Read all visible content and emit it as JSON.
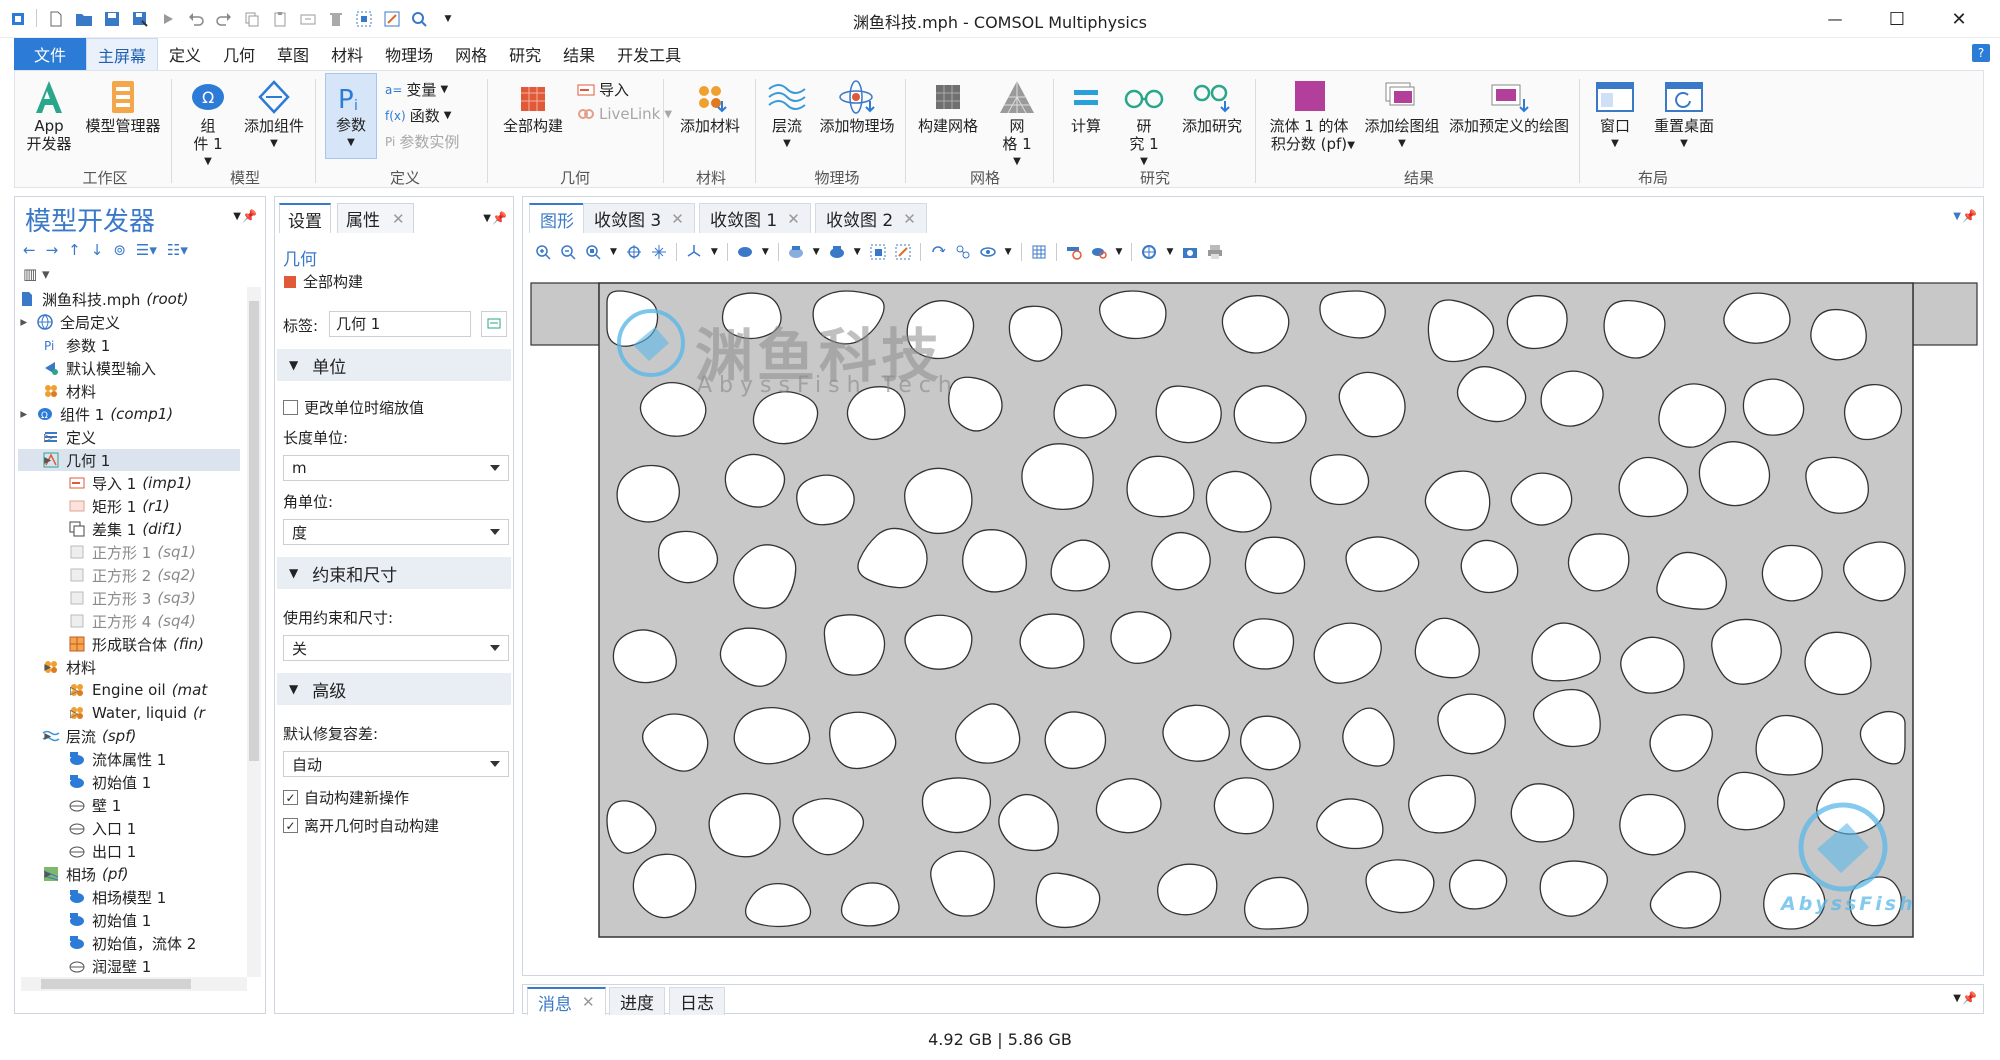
{
  "window": {
    "title": "渊鱼科技.mph - COMSOL Multiphysics",
    "minimize_glyph": "—",
    "maximize_glyph": "☐",
    "close_glyph": "✕"
  },
  "menu": {
    "items": [
      "文件",
      "主屏幕",
      "定义",
      "几何",
      "草图",
      "材料",
      "物理场",
      "网格",
      "研究",
      "结果",
      "开发工具"
    ],
    "active": "主屏幕",
    "help": "?"
  },
  "ribbon": {
    "workspace": {
      "label": "工作区",
      "app_dev": "App\n开发器",
      "model_manager": "模型管理器"
    },
    "model": {
      "label": "模型",
      "component": "组\n件 1",
      "add_component": "添加组件"
    },
    "definitions": {
      "label": "定义",
      "parameters": "参数",
      "variables": "变量",
      "functions": "函数",
      "param_case": "参数实例"
    },
    "geometry": {
      "label": "几何",
      "build_all": "全部构建",
      "import": "导入",
      "livelink": "LiveLink"
    },
    "materials": {
      "label": "材料",
      "add_material": "添加材料"
    },
    "physics": {
      "label": "物理场",
      "laminar": "层流",
      "add_physics": "添加物理场"
    },
    "mesh": {
      "label": "网格",
      "build_mesh": "构建网格",
      "mesh1": "网\n格 1"
    },
    "study": {
      "label": "研究",
      "compute": "计算",
      "study1": "研\n究 1",
      "add_study": "添加研究"
    },
    "results": {
      "label": "结果",
      "fluid_volume": "流体 1 的体\n积分数 (pf)",
      "add_plot_group": "添加绘图组",
      "add_predefined_plot": "添加预定义的绘图"
    },
    "layout": {
      "label": "布局",
      "window": "窗口",
      "reset_desktop": "重置桌面"
    }
  },
  "model_builder": {
    "title": "模型开发器",
    "tree": [
      {
        "label": "渊鱼科技.mph",
        "tag": "(root)",
        "level": 0,
        "icon": "file-icon",
        "toggle": ""
      },
      {
        "label": "全局定义",
        "tag": "",
        "level": 0,
        "icon": "globe-icon",
        "toggle": "▲"
      },
      {
        "label": "参数 1",
        "tag": "",
        "level": 1,
        "icon": "pi-icon",
        "toggle": ""
      },
      {
        "label": "默认模型输入",
        "tag": "",
        "level": 1,
        "icon": "model-input-icon",
        "toggle": ""
      },
      {
        "label": "材料",
        "tag": "",
        "level": 1,
        "icon": "material-icon",
        "toggle": ""
      },
      {
        "label": "组件 1",
        "tag": "(comp1)",
        "level": 0,
        "icon": "component-icon",
        "toggle": "▲"
      },
      {
        "label": "定义",
        "tag": "",
        "level": 1,
        "icon": "definitions-icon",
        "toggle": "▷"
      },
      {
        "label": "几何 1",
        "tag": "",
        "level": 1,
        "icon": "geometry-icon",
        "toggle": "▲",
        "selected": true
      },
      {
        "label": "导入 1",
        "tag": "(imp1)",
        "level": 2,
        "icon": "import-icon",
        "toggle": ""
      },
      {
        "label": "矩形 1",
        "tag": "(r1)",
        "level": 2,
        "icon": "rectangle-icon",
        "toggle": ""
      },
      {
        "label": "差集 1",
        "tag": "(dif1)",
        "level": 2,
        "icon": "difference-icon",
        "toggle": ""
      },
      {
        "label": "正方形 1",
        "tag": "(sq1)",
        "level": 2,
        "icon": "square-icon",
        "toggle": "",
        "dim": true
      },
      {
        "label": "正方形 2",
        "tag": "(sq2)",
        "level": 2,
        "icon": "square-icon",
        "toggle": "",
        "dim": true
      },
      {
        "label": "正方形 3",
        "tag": "(sq3)",
        "level": 2,
        "icon": "square-icon",
        "toggle": "",
        "dim": true
      },
      {
        "label": "正方形 4",
        "tag": "(sq4)",
        "level": 2,
        "icon": "square-icon",
        "toggle": "",
        "dim": true
      },
      {
        "label": "形成联合体",
        "tag": "(fin)",
        "level": 2,
        "icon": "form-union-icon",
        "toggle": ""
      },
      {
        "label": "材料",
        "tag": "",
        "level": 1,
        "icon": "material-icon",
        "toggle": "▲"
      },
      {
        "label": "Engine oil",
        "tag": "(mat",
        "level": 2,
        "icon": "material-icon",
        "toggle": "▷"
      },
      {
        "label": "Water, liquid",
        "tag": "(r",
        "level": 2,
        "icon": "material-icon",
        "toggle": "▷"
      },
      {
        "label": "层流",
        "tag": "(spf)",
        "level": 1,
        "icon": "laminar-icon",
        "toggle": "▲"
      },
      {
        "label": "流体属性 1",
        "tag": "",
        "level": 2,
        "icon": "domain-node-icon",
        "toggle": ""
      },
      {
        "label": "初始值 1",
        "tag": "",
        "level": 2,
        "icon": "domain-node-icon",
        "toggle": ""
      },
      {
        "label": "壁 1",
        "tag": "",
        "level": 2,
        "icon": "boundary-node-icon",
        "toggle": ""
      },
      {
        "label": "入口 1",
        "tag": "",
        "level": 2,
        "icon": "boundary-node-icon",
        "toggle": ""
      },
      {
        "label": "出口 1",
        "tag": "",
        "level": 2,
        "icon": "boundary-node-icon",
        "toggle": ""
      },
      {
        "label": "相场",
        "tag": "(pf)",
        "level": 1,
        "icon": "phase-field-icon",
        "toggle": "▲"
      },
      {
        "label": "相场模型 1",
        "tag": "",
        "level": 2,
        "icon": "domain-node-icon",
        "toggle": ""
      },
      {
        "label": "初始值 1",
        "tag": "",
        "level": 2,
        "icon": "domain-node-icon",
        "toggle": ""
      },
      {
        "label": "初始值，流体 2",
        "tag": "",
        "level": 2,
        "icon": "domain-node-icon",
        "toggle": ""
      },
      {
        "label": "润湿壁 1",
        "tag": "",
        "level": 2,
        "icon": "boundary-node-icon",
        "toggle": ""
      }
    ]
  },
  "settings": {
    "tabs": [
      "设置",
      "属性"
    ],
    "node_type": "几何",
    "build_all": "全部构建",
    "label_caption": "标签:",
    "label_value": "几何 1",
    "sections": {
      "units": {
        "title": "单位",
        "scale_checkbox": "更改单位时缩放值",
        "scale_checked": false,
        "length_label": "长度单位:",
        "length_value": "m",
        "angle_label": "角单位:",
        "angle_value": "度"
      },
      "constraints": {
        "title": "约束和尺寸",
        "use_label": "使用约束和尺寸:",
        "use_value": "关"
      },
      "advanced": {
        "title": "高级",
        "repair_label": "默认修复容差:",
        "repair_value": "自动",
        "auto_build_new": "自动构建新操作",
        "auto_build_new_checked": true,
        "auto_build_leave": "离开几何时自动构建",
        "auto_build_leave_checked": true
      }
    }
  },
  "graphics": {
    "tabs": [
      "图形",
      "收敛图 3",
      "收敛图 1",
      "收敛图 2"
    ],
    "watermark_cn": "渊鱼科技",
    "watermark_en": "AbyssFish Tech",
    "watermark_logo": "AbyssFish"
  },
  "bottom_tabs": [
    "消息",
    "进度",
    "日志"
  ],
  "status": {
    "memory": "4.92 GB | 5.86 GB"
  },
  "colors": {
    "accent": "#2c7bd6",
    "fluid": "#c8c8c8",
    "grain": "#ffffff",
    "watermark": "#5bb8e8"
  }
}
